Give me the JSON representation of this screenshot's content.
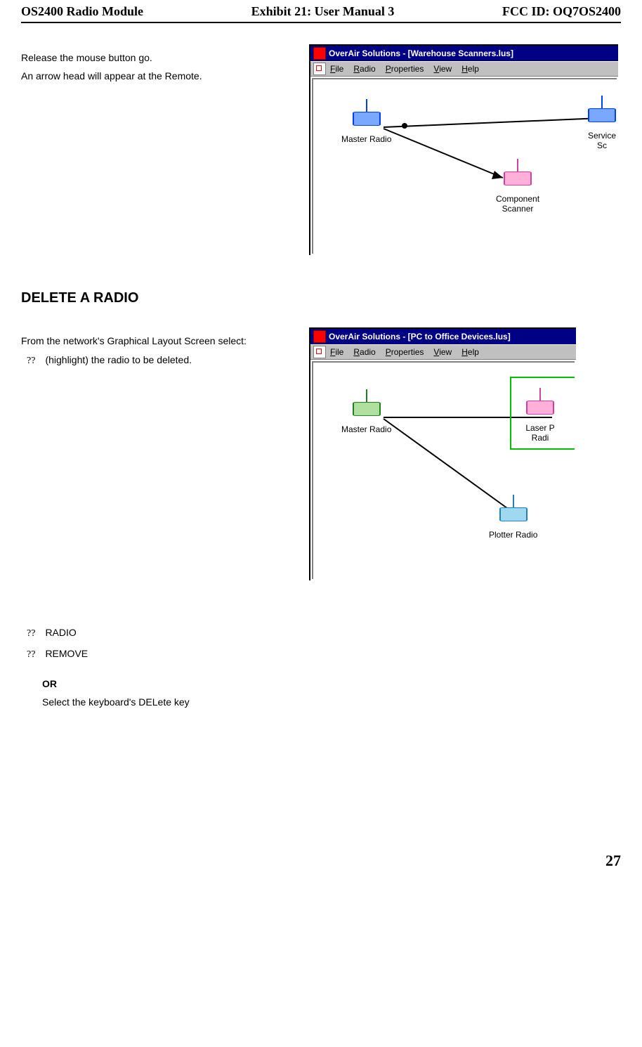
{
  "header": {
    "left": "OS2400 Radio Module",
    "center": "Exhibit 21: User Manual 3",
    "right": "FCC ID: OQ7OS2400"
  },
  "section1": {
    "line1": "Release the mouse button go.",
    "line2": "An arrow head will appear at the Remote."
  },
  "app1": {
    "title": "OverAir Solutions - [Warehouse Scanners.lus]",
    "menu_file": "File",
    "menu_file_u": "F",
    "menu_radio": "Radio",
    "menu_radio_u": "R",
    "menu_properties": "Properties",
    "menu_properties_u": "P",
    "menu_view": "View",
    "menu_view_u": "V",
    "menu_help": "Help",
    "menu_help_u": "H",
    "node_master": "Master Radio",
    "node_component": "Component\nScanner",
    "node_service": "Service Sc"
  },
  "heading_delete": "DELETE A RADIO",
  "section2": {
    "intro": "From the network's Graphical Layout Screen select:",
    "bullet1": "(highlight) the radio to be deleted."
  },
  "app2": {
    "title": "OverAir Solutions - [PC to Office Devices.lus]",
    "menu_file": "File",
    "menu_file_u": "F",
    "menu_radio": "Radio",
    "menu_radio_u": "R",
    "menu_properties": "Properties",
    "menu_properties_u": "P",
    "menu_view": "View",
    "menu_view_u": "V",
    "menu_help": "Help",
    "menu_help_u": "H",
    "node_master": "Master Radio",
    "node_laser": "Laser P\nRadi",
    "node_plotter": "Plotter Radio"
  },
  "bullets_after": {
    "b1": "RADIO",
    "b2": "REMOVE"
  },
  "or_block": {
    "or": "OR",
    "line": "Select the keyboard's DELete key"
  },
  "page_num": "27",
  "qq": "??"
}
